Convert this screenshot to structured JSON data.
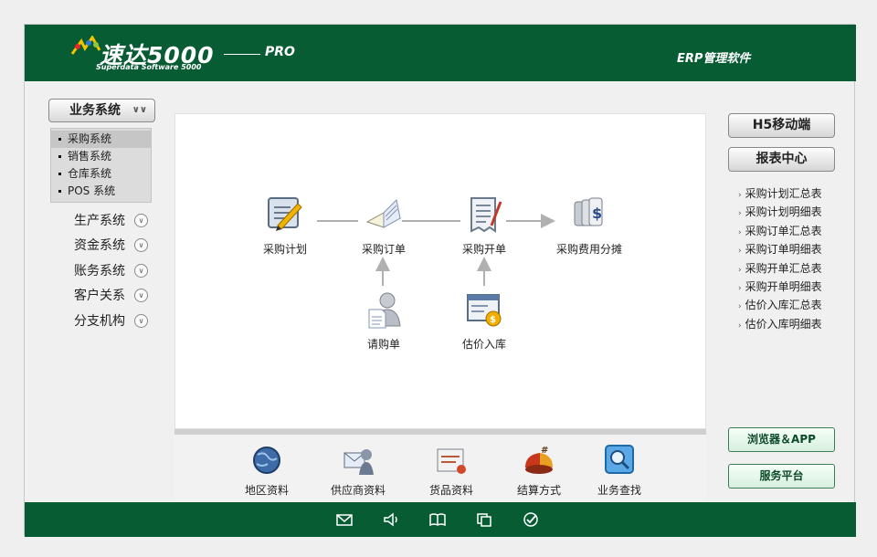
{
  "header": {
    "brand": "速达5000",
    "edition": "PRO",
    "subtitle": "Superdata Software 5000",
    "product_label": "ERP管理软件"
  },
  "left_sidebar": {
    "main_button": "业务系统",
    "submenu": [
      {
        "label": "采购系统",
        "selected": true
      },
      {
        "label": "销售系统",
        "selected": false
      },
      {
        "label": "仓库系统",
        "selected": false
      },
      {
        "label": "POS 系统",
        "selected": false
      }
    ],
    "systems": [
      "生产系统",
      "资金系统",
      "账务系统",
      "客户关系",
      "分支机构"
    ]
  },
  "flow": {
    "nodes": [
      {
        "label": "采购计划",
        "icon": "plan-icon"
      },
      {
        "label": "采购订单",
        "icon": "order-book-icon"
      },
      {
        "label": "采购开单",
        "icon": "receipt-icon"
      },
      {
        "label": "采购费用分摊",
        "icon": "cost-allocation-icon"
      },
      {
        "label": "请购单",
        "icon": "request-person-icon"
      },
      {
        "label": "估价入库",
        "icon": "valuation-stock-icon"
      }
    ]
  },
  "bottom_bar": [
    {
      "label": "地区资料",
      "icon": "globe-icon"
    },
    {
      "label": "供应商资料",
      "icon": "supplier-icon"
    },
    {
      "label": "货品资料",
      "icon": "goods-icon"
    },
    {
      "label": "结算方式",
      "icon": "settlement-icon"
    },
    {
      "label": "业务查找",
      "icon": "search-icon"
    }
  ],
  "right_sidebar": {
    "h5_button": "H5移动端",
    "report_button": "报表中心",
    "reports": [
      "采购计划汇总表",
      "采购计划明细表",
      "采购订单汇总表",
      "采购订单明细表",
      "采购开单汇总表",
      "采购开单明细表",
      "估价入库汇总表",
      "估价入库明细表"
    ],
    "browser_app_button": "浏览器＆APP",
    "service_button": "服务平台"
  },
  "footer": {
    "icons": [
      "mail-icon",
      "speaker-icon",
      "book-icon",
      "copy-icon",
      "check-icon"
    ]
  },
  "colors": {
    "brand_green": "#075c34"
  }
}
